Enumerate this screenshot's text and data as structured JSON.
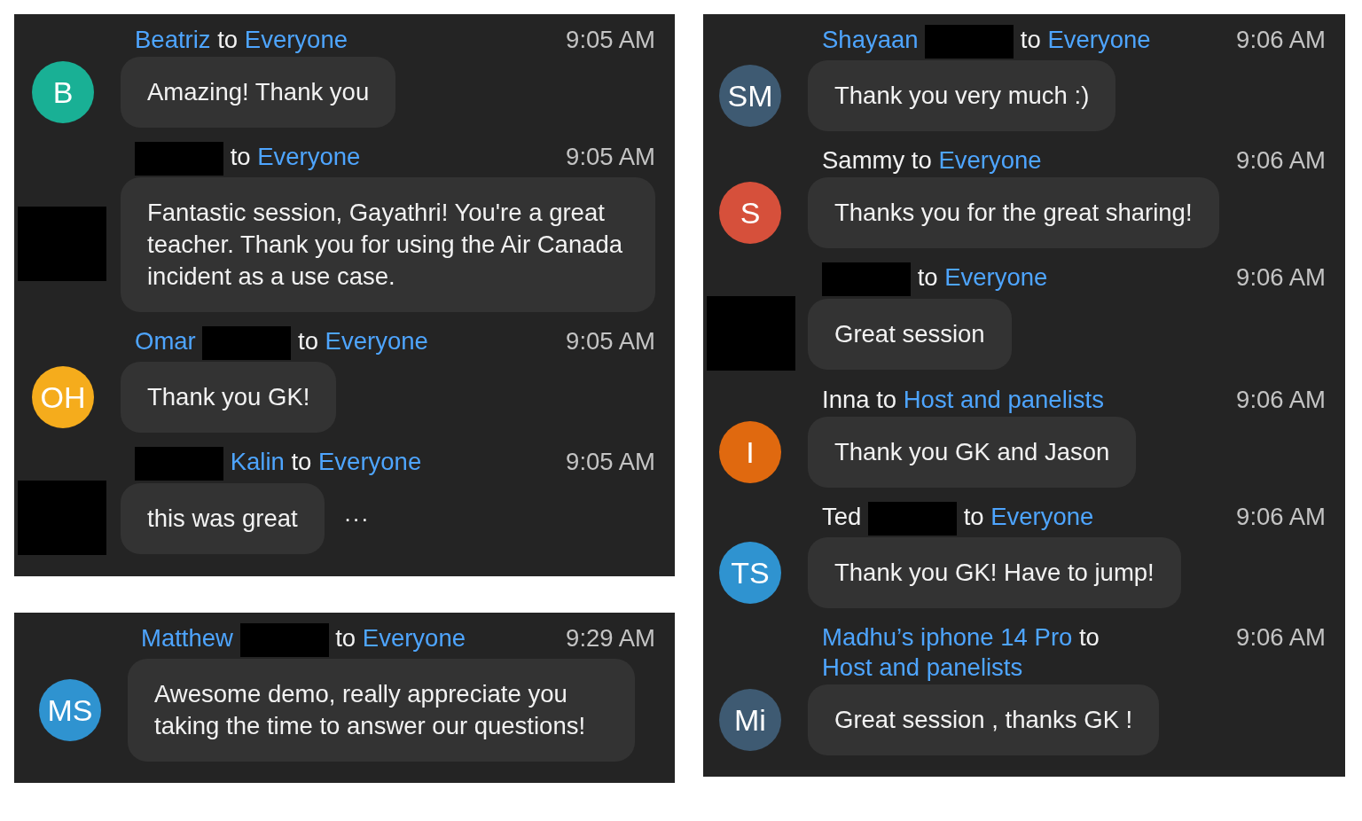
{
  "panels": [
    {
      "messages": [
        {
          "header": [
            {
              "kind": "link",
              "text": "Beatriz"
            },
            {
              "kind": "plain",
              "text": "to"
            },
            {
              "kind": "link",
              "text": "Everyone"
            }
          ],
          "time": "9:05 AM",
          "avatar": {
            "kind": "initials",
            "initials": "B",
            "color": "#19b095"
          },
          "text": "Amazing! Thank you"
        },
        {
          "header": [
            {
              "kind": "redacted"
            },
            {
              "kind": "plain",
              "text": "to"
            },
            {
              "kind": "link",
              "text": "Everyone"
            }
          ],
          "time": "9:05 AM",
          "avatar": {
            "kind": "redacted"
          },
          "text": "Fantastic session, Gayathri! You're a great teacher. Thank you for using the Air Canada incident as a use case."
        },
        {
          "header": [
            {
              "kind": "link",
              "text": "Omar"
            },
            {
              "kind": "redacted"
            },
            {
              "kind": "plain",
              "text": "to"
            },
            {
              "kind": "link",
              "text": "Everyone"
            }
          ],
          "time": "9:05 AM",
          "avatar": {
            "kind": "initials",
            "initials": "OH",
            "color": "#f5ac1c"
          },
          "text": "Thank you GK!"
        },
        {
          "header": [
            {
              "kind": "redacted"
            },
            {
              "kind": "link",
              "text": "Kalin"
            },
            {
              "kind": "plain",
              "text": "to"
            },
            {
              "kind": "link",
              "text": "Everyone"
            }
          ],
          "time": "9:05 AM",
          "avatar": {
            "kind": "redacted"
          },
          "text": "this was great",
          "more": "···"
        }
      ]
    },
    {
      "messages": [
        {
          "header": [
            {
              "kind": "link",
              "text": "Matthew"
            },
            {
              "kind": "redacted"
            },
            {
              "kind": "plain",
              "text": "to"
            },
            {
              "kind": "link",
              "text": "Everyone"
            }
          ],
          "time": "9:29 AM",
          "avatar": {
            "kind": "initials",
            "initials": "MS",
            "color": "#2f93d0"
          },
          "text": "Awesome demo, really appreciate you taking the time to answer our questions!"
        }
      ]
    },
    {
      "messages": [
        {
          "header": [
            {
              "kind": "link",
              "text": "Shayaan"
            },
            {
              "kind": "redacted"
            },
            {
              "kind": "plain",
              "text": "to"
            },
            {
              "kind": "link",
              "text": "Everyone"
            }
          ],
          "time": "9:06 AM",
          "avatar": {
            "kind": "initials",
            "initials": "SM",
            "color": "#3e5a72"
          },
          "text": "Thank you very much :)"
        },
        {
          "header": [
            {
              "kind": "plain",
              "text": "Sammy"
            },
            {
              "kind": "plain",
              "text": "to"
            },
            {
              "kind": "link",
              "text": "Everyone"
            }
          ],
          "time": "9:06 AM",
          "avatar": {
            "kind": "initials",
            "initials": "S",
            "color": "#d6503b"
          },
          "text": "Thanks you for the great sharing!"
        },
        {
          "header": [
            {
              "kind": "redacted"
            },
            {
              "kind": "plain",
              "text": "to"
            },
            {
              "kind": "link",
              "text": "Everyone"
            }
          ],
          "time": "9:06 AM",
          "avatar": {
            "kind": "redacted"
          },
          "text": "Great session"
        },
        {
          "header": [
            {
              "kind": "plain",
              "text": "Inna"
            },
            {
              "kind": "plain",
              "text": "to"
            },
            {
              "kind": "link",
              "text": "Host and panelists"
            }
          ],
          "time": "9:06 AM",
          "avatar": {
            "kind": "initials",
            "initials": "I",
            "color": "#e0690f"
          },
          "text": "Thank you GK and Jason"
        },
        {
          "header": [
            {
              "kind": "plain",
              "text": "Ted"
            },
            {
              "kind": "redacted"
            },
            {
              "kind": "plain",
              "text": "to"
            },
            {
              "kind": "link",
              "text": "Everyone"
            }
          ],
          "time": "9:06 AM",
          "avatar": {
            "kind": "initials",
            "initials": "TS",
            "color": "#2f93d0"
          },
          "text": "Thank you GK! Have to jump!"
        },
        {
          "header": [
            {
              "kind": "link",
              "text": "Madhu’s iphone 14 Pro"
            },
            {
              "kind": "plain",
              "text": "to"
            },
            {
              "kind": "link",
              "text": "Host and panelists"
            }
          ],
          "time": "9:06 AM",
          "avatar": {
            "kind": "initials",
            "initials": "Mi",
            "color": "#3e5a72"
          },
          "text": "Great session , thanks GK !"
        }
      ]
    }
  ]
}
